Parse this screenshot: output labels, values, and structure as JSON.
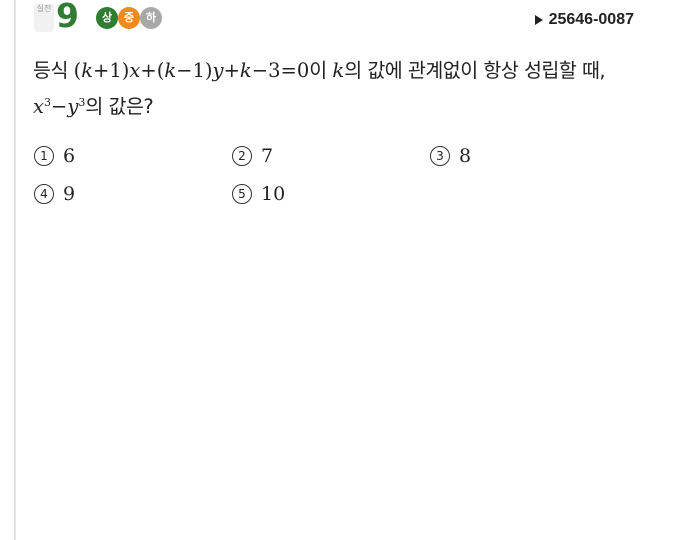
{
  "problem": {
    "number_prefix": "실전",
    "number": "9",
    "difficulty": {
      "high_label": "상",
      "mid_label": "중",
      "low_label": "하"
    },
    "code": "25646-0087"
  },
  "question": {
    "text_1": "등식 ",
    "eq_open_1": "(",
    "k_1": "k",
    "plus_one": "+1)",
    "x_1": "x",
    "plus_open": "+(",
    "k_2": "k",
    "minus_one": "−1)",
    "y_1": "y",
    "plus": "+",
    "k_3": "k",
    "minus_three_zero": "−3=0",
    "text_2": "이 ",
    "k_4": "k",
    "text_3": "의 값에 관계없이 항상 성립할 때, ",
    "x_2": "x",
    "exp_1": "3",
    "minus": "−",
    "y_2": "y",
    "exp_2": "3",
    "text_4": "의 값은?"
  },
  "choices": [
    {
      "mark": "1",
      "value": "6"
    },
    {
      "mark": "2",
      "value": "7"
    },
    {
      "mark": "3",
      "value": "8"
    },
    {
      "mark": "4",
      "value": "9"
    },
    {
      "mark": "5",
      "value": "10"
    }
  ],
  "colors": {
    "number": "#2e7d32",
    "difficulty_high": "#2e7d32",
    "difficulty_mid": "#f08a1c",
    "difficulty_low": "#a8a8a8"
  }
}
